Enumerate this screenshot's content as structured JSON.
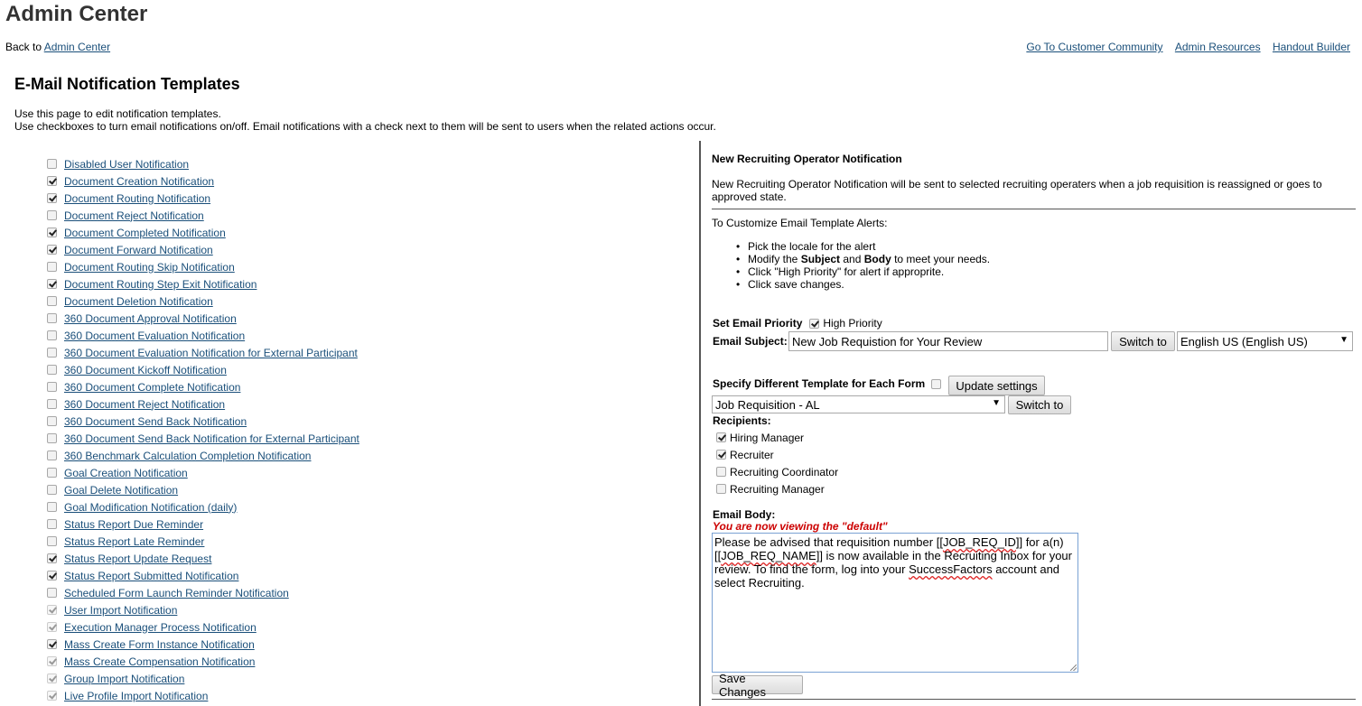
{
  "header": {
    "title": "Admin Center",
    "back_prefix": "Back to ",
    "back_link": "Admin Center",
    "top_links": [
      "Go To Customer Community",
      "Admin Resources",
      "Handout Builder"
    ]
  },
  "page": {
    "heading": "E-Mail Notification Templates",
    "intro_line1": "Use this page to edit notification templates.",
    "intro_line2": "Use checkboxes to turn email notifications on/off. Email notifications with a check next to them will be sent to users when the related actions occur."
  },
  "notifications": [
    {
      "label": "Disabled User Notification",
      "checked": false,
      "disabled": false
    },
    {
      "label": "Document Creation Notification",
      "checked": true,
      "disabled": false
    },
    {
      "label": "Document Routing Notification",
      "checked": true,
      "disabled": false
    },
    {
      "label": "Document Reject Notification",
      "checked": false,
      "disabled": false
    },
    {
      "label": "Document Completed Notification",
      "checked": true,
      "disabled": false
    },
    {
      "label": "Document Forward Notification",
      "checked": true,
      "disabled": false
    },
    {
      "label": "Document Routing Skip Notification",
      "checked": false,
      "disabled": false
    },
    {
      "label": "Document Routing Step Exit Notification",
      "checked": true,
      "disabled": false
    },
    {
      "label": "Document Deletion Notification",
      "checked": false,
      "disabled": false
    },
    {
      "label": "360 Document Approval Notification",
      "checked": false,
      "disabled": false
    },
    {
      "label": "360 Document Evaluation Notification",
      "checked": false,
      "disabled": false
    },
    {
      "label": "360 Document Evaluation Notification for External Participant",
      "checked": false,
      "disabled": false
    },
    {
      "label": "360 Document Kickoff Notification",
      "checked": false,
      "disabled": false
    },
    {
      "label": "360 Document Complete Notification",
      "checked": false,
      "disabled": false
    },
    {
      "label": "360 Document Reject Notification",
      "checked": false,
      "disabled": false
    },
    {
      "label": "360 Document Send Back Notification",
      "checked": false,
      "disabled": false
    },
    {
      "label": "360 Document Send Back Notification for External Participant",
      "checked": false,
      "disabled": false
    },
    {
      "label": "360 Benchmark Calculation Completion Notification",
      "checked": false,
      "disabled": false
    },
    {
      "label": "Goal Creation Notification",
      "checked": false,
      "disabled": false
    },
    {
      "label": "Goal Delete Notification",
      "checked": false,
      "disabled": false
    },
    {
      "label": "Goal Modification Notification (daily)",
      "checked": false,
      "disabled": false
    },
    {
      "label": "Status Report Due Reminder",
      "checked": false,
      "disabled": false
    },
    {
      "label": "Status Report Late Reminder",
      "checked": false,
      "disabled": false
    },
    {
      "label": "Status Report Update Request",
      "checked": true,
      "disabled": false
    },
    {
      "label": "Status Report Submitted Notification",
      "checked": true,
      "disabled": false
    },
    {
      "label": "Scheduled Form Launch Reminder Notification",
      "checked": false,
      "disabled": false
    },
    {
      "label": "User Import Notification",
      "checked": true,
      "disabled": true
    },
    {
      "label": "Execution Manager Process Notification",
      "checked": true,
      "disabled": true
    },
    {
      "label": "Mass Create Form Instance Notification",
      "checked": true,
      "disabled": false
    },
    {
      "label": "Mass Create Compensation Notification",
      "checked": true,
      "disabled": true
    },
    {
      "label": "Group Import Notification",
      "checked": true,
      "disabled": true
    },
    {
      "label": "Live Profile Import Notification",
      "checked": true,
      "disabled": true
    }
  ],
  "detail": {
    "title": "New Recruiting Operator Notification",
    "description": "New Recruiting Operator Notification will be sent to selected recruiting operaters when a job requisition is reassigned or goes to approved state.",
    "customize_heading": "To Customize Email Template Alerts:",
    "steps": {
      "s1": "Pick the locale for the alert",
      "s2_pre": "Modify the ",
      "s2_subject": "Subject",
      "s2_and": " and ",
      "s2_body": "Body",
      "s2_post": " to meet your needs.",
      "s3": "Click \"High Priority\" for alert if approprite.",
      "s4": "Click save changes."
    },
    "priority_label": "Set Email Priority",
    "high_priority_label": "High Priority",
    "high_priority_checked": true,
    "subject_label": "Email Subject:",
    "subject_value": "New Job Requistion for Your Review",
    "switch_to_label": "Switch to",
    "locale_value": "English US (English US)",
    "diff_template_label": "Specify Different Template for Each Form",
    "diff_template_checked": false,
    "update_settings_label": "Update settings",
    "form_value": "Job Requisition - AL",
    "recipients_label": "Recipients:",
    "recipients": [
      {
        "label": "Hiring Manager",
        "checked": true
      },
      {
        "label": "Recruiter",
        "checked": true
      },
      {
        "label": "Recruiting Coordinator",
        "checked": false
      },
      {
        "label": "Recruiting Manager",
        "checked": false
      }
    ],
    "body_label": "Email Body:",
    "viewing_note": "You are now viewing the \"default\"",
    "body": {
      "p1": "Please be advised that requisition number [[",
      "w1": "JOB_REQ_ID",
      "p2": "]] for a(n) [[",
      "w2": "JOB_REQ_NAME",
      "p3": "]] is now available in the Recruiting Inbox for your review. To find the form, log into your ",
      "w3": "SuccessFactors",
      "p4": " account and select Recruiting."
    },
    "save_label": "Save Changes",
    "colors": {
      "link": "#1a4f7a",
      "viewing_note": "#cc0000",
      "focus_border": "#7aa2d4"
    }
  }
}
